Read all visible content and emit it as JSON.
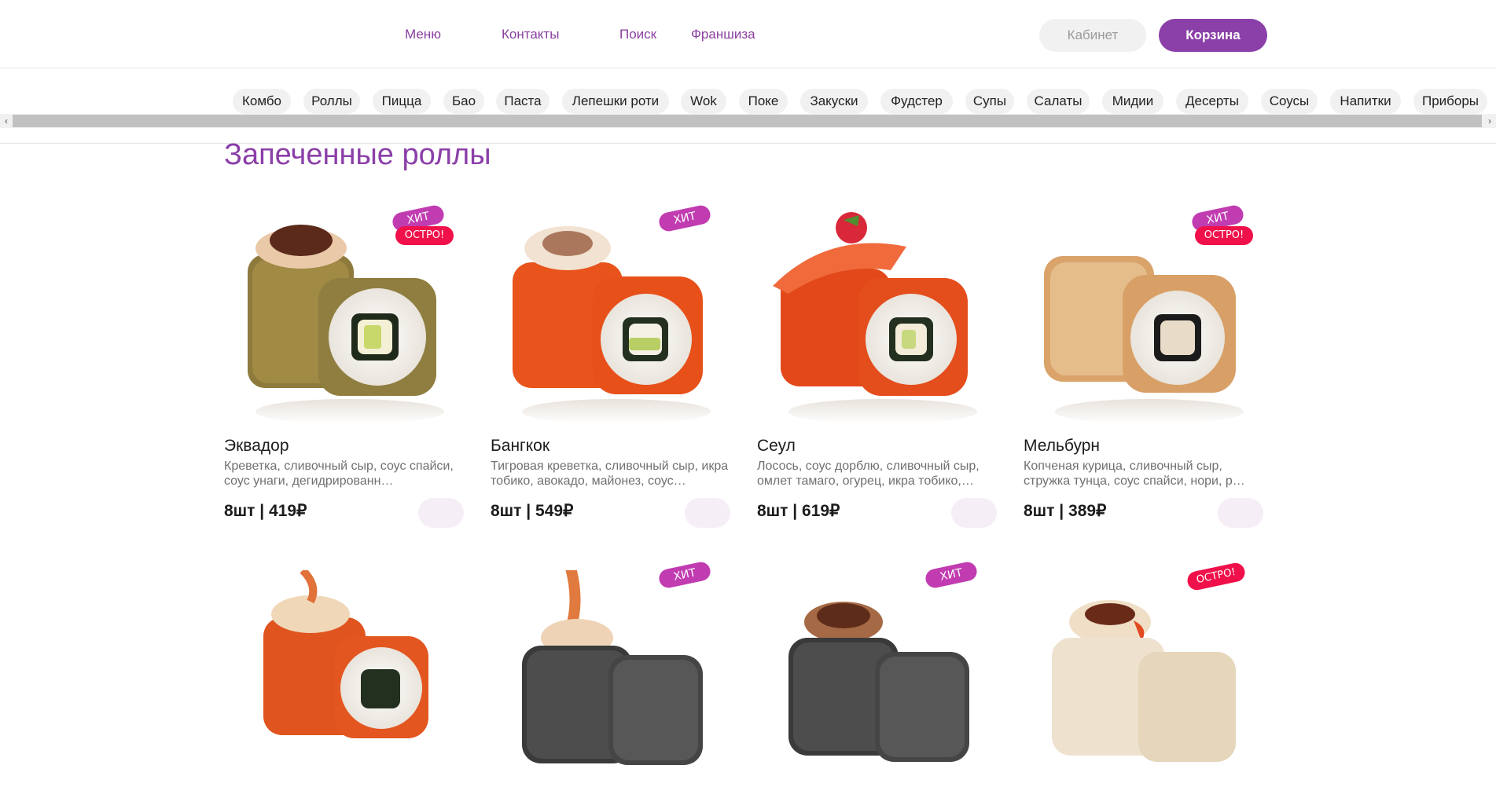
{
  "header": {
    "nav": [
      "Меню",
      "Контакты",
      "Поиск",
      "Франшиза"
    ],
    "cabinet_label": "Кабинет",
    "cart_label": "Корзина"
  },
  "categories": [
    "Комбо",
    "Роллы",
    "Пицца",
    "Бао",
    "Паста",
    "Лепешки роти",
    "Wok",
    "Поке",
    "Закуски",
    "Фудстер",
    "Супы",
    "Салаты",
    "Мидии",
    "Десерты",
    "Соусы",
    "Напитки",
    "Приборы"
  ],
  "scrollbar": {
    "left_arrow": "‹",
    "right_arrow": "›"
  },
  "section_title": "Запеченные роллы",
  "badge_labels": {
    "hit": "ХИТ",
    "hot": "ОСТРО!"
  },
  "products": [
    {
      "name": "Эквадор",
      "desc": "Креветка, сливочный сыр, соус спайси, соус унаги, дегидрированн…",
      "price": "8шт | 419₽",
      "badges": [
        "hit",
        "hot"
      ]
    },
    {
      "name": "Бангкок",
      "desc": "Тигровая креветка, сливочный сыр, икра тобико, авокадо, майонез, соус…",
      "price": "8шт | 549₽",
      "badges": [
        "hit"
      ]
    },
    {
      "name": "Сеул",
      "desc": "Лосось, соус дорблю, сливочный сыр, омлет тамаго, огурец, икра тобико,…",
      "price": "8шт | 619₽",
      "badges": []
    },
    {
      "name": "Мельбурн",
      "desc": "Копченая курица, сливочный сыр, стружка тунца, соус спайси, нори, р…",
      "price": "8шт | 389₽",
      "badges": [
        "hit",
        "hot"
      ]
    },
    {
      "name": "",
      "desc": "",
      "price": "",
      "badges": []
    },
    {
      "name": "",
      "desc": "",
      "price": "",
      "badges": [
        "hit"
      ]
    },
    {
      "name": "",
      "desc": "",
      "price": "",
      "badges": [
        "hit"
      ]
    },
    {
      "name": "",
      "desc": "",
      "price": "",
      "badges": [
        "hot"
      ]
    }
  ],
  "colors": {
    "accent": "#8b3fa8",
    "hit_badge": "#c13cb1",
    "hot_badge": "#f0104a"
  }
}
